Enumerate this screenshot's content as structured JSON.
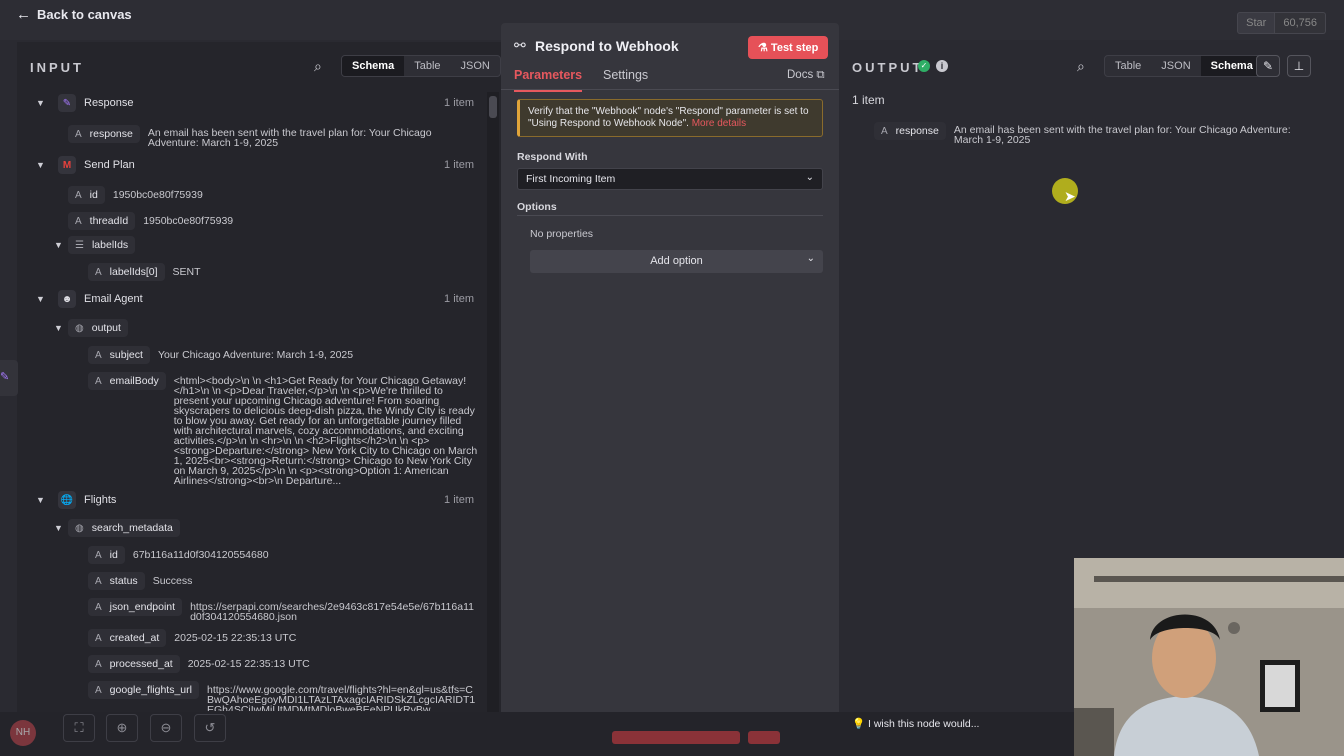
{
  "topbar": {
    "back_label": "Back to canvas",
    "github_star": "Star",
    "github_count": "60,756"
  },
  "input": {
    "title": "INPUT",
    "tabs": [
      "Schema",
      "Table",
      "JSON"
    ],
    "response_node": {
      "name": "Response",
      "count": "1 item",
      "field": "response",
      "value": "An email has been sent with the travel plan for: Your Chicago Adventure: March 1-9, 2025"
    },
    "send_plan": {
      "name": "Send Plan",
      "count": "1 item",
      "id_key": "id",
      "id_val": "1950bc0e80f75939",
      "thread_key": "threadId",
      "thread_val": "1950bc0e80f75939",
      "labels_key": "labelIds",
      "label0_key": "labelIds[0]",
      "label0_val": "SENT"
    },
    "email_agent": {
      "name": "Email Agent",
      "count": "1 item",
      "output_key": "output",
      "subject_key": "subject",
      "subject_val": "Your Chicago Adventure: March 1-9, 2025",
      "body_key": "emailBody",
      "body_val": "<html><body>\\n \\n <h1>Get Ready for Your Chicago Getaway!</h1>\\n \\n <p>Dear Traveler,</p>\\n \\n <p>We're thrilled to present your upcoming Chicago adventure! From soaring skyscrapers to delicious deep-dish pizza, the Windy City is ready to blow you away. Get ready for an unforgettable journey filled with architectural marvels, cozy accommodations, and exciting activities.</p>\\n \\n <hr>\\n \\n <h2>Flights</h2>\\n \\n <p><strong>Departure:</strong> New York City to Chicago on March 1, 2025<br><strong>Return:</strong> Chicago to New York City on March 9, 2025</p>\\n \\n <p><strong>Option 1: American Airlines</strong><br>\\n Departure..."
    },
    "flights": {
      "name": "Flights",
      "count": "1 item",
      "meta_key": "search_metadata",
      "id_key": "id",
      "id_val": "67b116a11d0f304120554680",
      "status_key": "status",
      "status_val": "Success",
      "json_key": "json_endpoint",
      "json_val": "https://serpapi.com/searches/2e9463c817e54e5e/67b116a11d0f304120554680.json",
      "created_key": "created_at",
      "created_val": "2025-02-15 22:35:13 UTC",
      "processed_key": "processed_at",
      "processed_val": "2025-02-15 22:35:13 UTC",
      "gflights_key": "google_flights_url",
      "gflights_val": "https://www.google.com/travel/flights?hl=en&gl=us&tfs=CBwQAhoeEgoyMDI1LTAzLTAxagcIARIDSkZLcgcIARIDT1EGh4SCiIwMjUtMDMtMDloBweBEeNPUkRvBw"
    },
    "type_letter": "A"
  },
  "node": {
    "title": "Respond to Webhook",
    "test_step": "Test step",
    "tab_params": "Parameters",
    "tab_settings": "Settings",
    "docs": "Docs",
    "warning": "Verify that the \"Webhook\" node's \"Respond\" parameter is set to \"Using Respond to Webhook Node\".",
    "more_details": "More details",
    "respond_with_label": "Respond With",
    "respond_with_value": "First Incoming Item",
    "options_label": "Options",
    "no_properties": "No properties",
    "add_option": "Add option"
  },
  "output": {
    "title": "OUTPUT",
    "tabs": [
      "Table",
      "JSON",
      "Schema"
    ],
    "items": "1 item",
    "field": "response",
    "value": "An email has been sent with the travel plan for: Your Chicago Adventure: March 1-9, 2025"
  },
  "footer": {
    "wish": "I wish this node would...",
    "avatar": "NH"
  },
  "colors": {
    "accent": "#e6585e",
    "success": "#2fae66",
    "warning": "#e0a43a"
  }
}
